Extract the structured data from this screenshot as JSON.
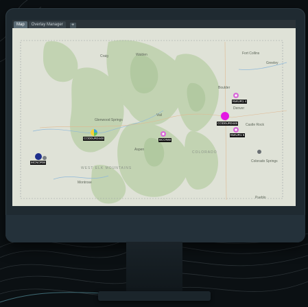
{
  "tabs": [
    {
      "label": "Map",
      "active": true
    },
    {
      "label": "Overlay Manager",
      "active": false
    }
  ],
  "add_tab_label": "+",
  "map": {
    "places": [
      "Fort Collins",
      "Greeley",
      "Boulder",
      "Denver",
      "Castle Rock",
      "Colorado Springs",
      "Pueblo",
      "Montrose",
      "Glenwood Springs",
      "Craig",
      "Walden",
      "Vail",
      "Aspen"
    ],
    "regions": [
      "COLORADO",
      "WEST ELK MOUNTAINS"
    ],
    "sites": [
      {
        "label": "NWUR1 4",
        "color": "#d86ad8"
      },
      {
        "label": "COD0UR0448",
        "color": "#e318e3"
      },
      {
        "label": "NWUR1 5",
        "color": "#d86ad8"
      },
      {
        "label": "BCONW",
        "color": "#d86ad8"
      },
      {
        "label": "COD0UR0448",
        "color": "#f3d33a"
      },
      {
        "label": "MCNORW",
        "color": "#1e2f8c"
      }
    ]
  }
}
